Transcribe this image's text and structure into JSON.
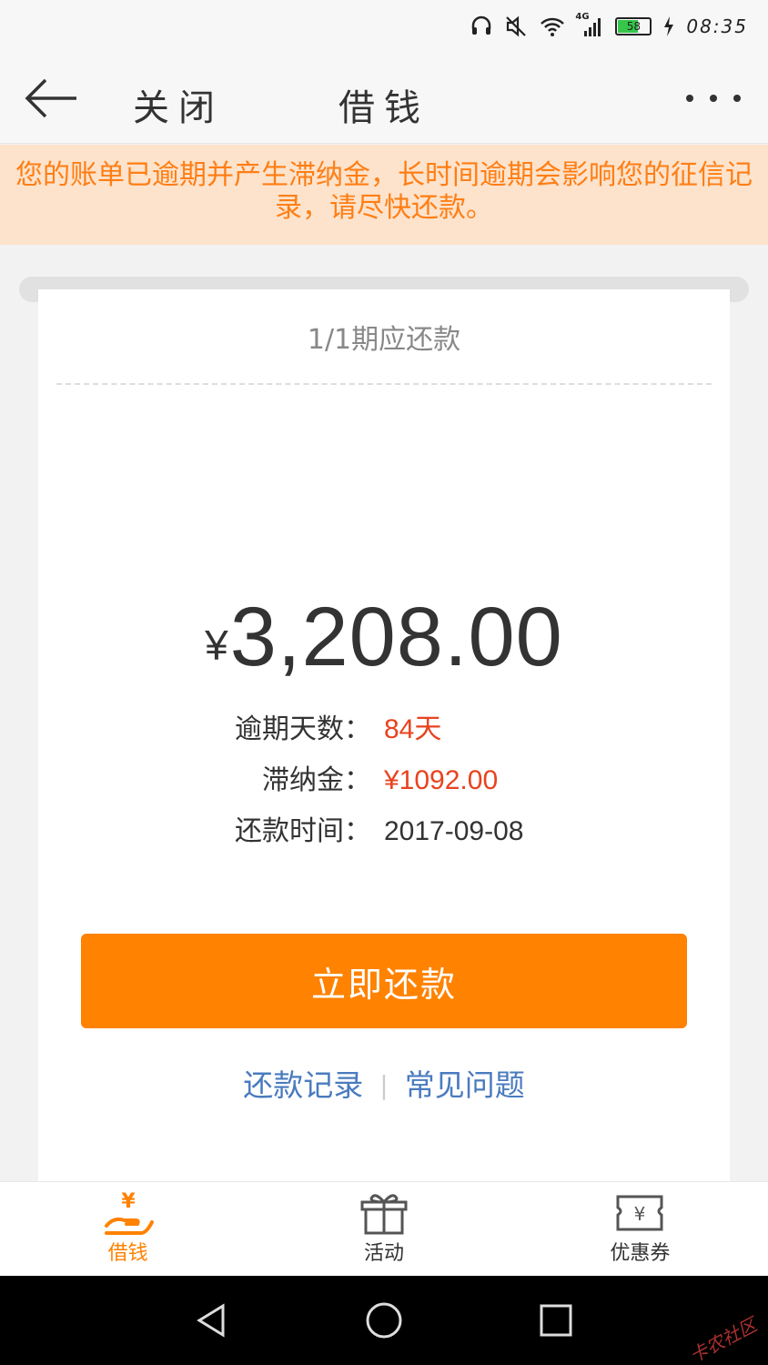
{
  "status_bar": {
    "network": "4G",
    "battery": "58",
    "time": "08:35"
  },
  "nav": {
    "close_label": "关闭",
    "title": "借钱"
  },
  "notice": {
    "text": "您的账单已逾期并产生滞纳金，长时间逾期会影响您的征信记录，请尽快还款。"
  },
  "bill": {
    "period": "1/1期应还款",
    "currency_symbol": "¥",
    "amount": "3,208.00",
    "overdue_days_label": "逾期天数：",
    "overdue_days_value": "84天",
    "late_fee_label": "滞纳金：",
    "late_fee_value": "¥1092.00",
    "due_date_label": "还款时间：",
    "due_date_value": "2017-09-08",
    "pay_button": "立即还款",
    "repay_records_link": "还款记录",
    "separator": "|",
    "faq_link": "常见问题"
  },
  "tabs": [
    {
      "label": "借钱",
      "icon": "yuan-hand-icon",
      "active": true
    },
    {
      "label": "活动",
      "icon": "gift-icon",
      "active": false
    },
    {
      "label": "优惠券",
      "icon": "coupon-icon",
      "active": false
    }
  ],
  "colors": {
    "accent": "#ff8200",
    "notice_bg": "#fde3cc",
    "notice_text": "#ff7e14",
    "warning_red": "#e8431e",
    "link_blue": "#4a7bbf"
  },
  "watermark": "卡农社区"
}
